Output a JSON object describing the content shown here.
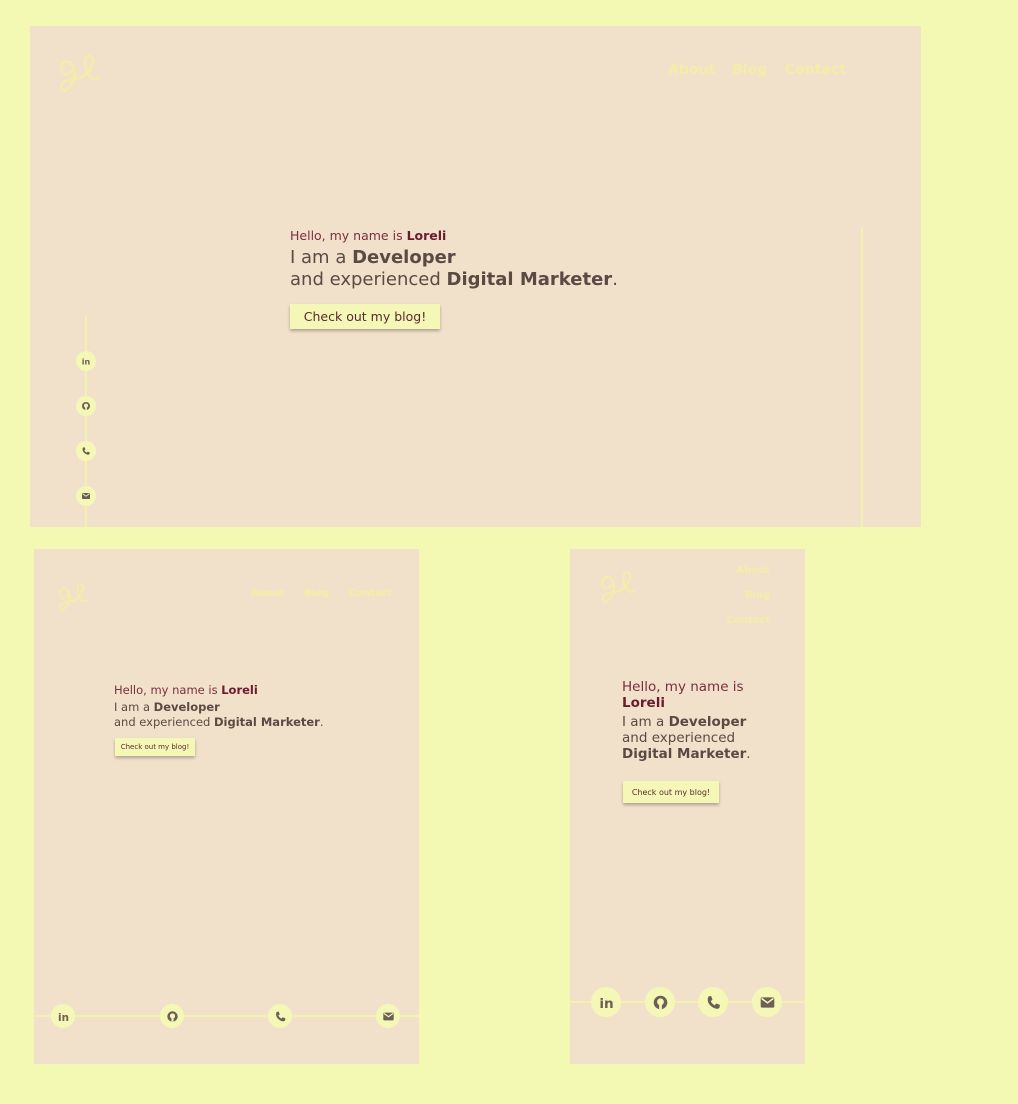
{
  "colors": {
    "page_background": "#f3f9b3",
    "frame_background": "#f1e1ca",
    "accent": "#f5f7b6",
    "name_color": "#6a1b2e",
    "text": "#5a4a44"
  },
  "logo": {
    "icon": "signature-logo-icon"
  },
  "nav": {
    "about": "About",
    "blog": "Blog",
    "contact": "Contact"
  },
  "hero": {
    "hello_prefix": "Hello, my name is ",
    "name": "Loreli",
    "iam_prefix": "I am a ",
    "role": "Developer",
    "and_prefix": "and experienced ",
    "role2": "Digital Marketer",
    "period": ".",
    "cta_label": "Check out my blog!"
  },
  "social": [
    {
      "icon": "linkedin-icon",
      "glyph": "in"
    },
    {
      "icon": "github-icon"
    },
    {
      "icon": "phone-icon"
    },
    {
      "icon": "mail-icon"
    }
  ]
}
